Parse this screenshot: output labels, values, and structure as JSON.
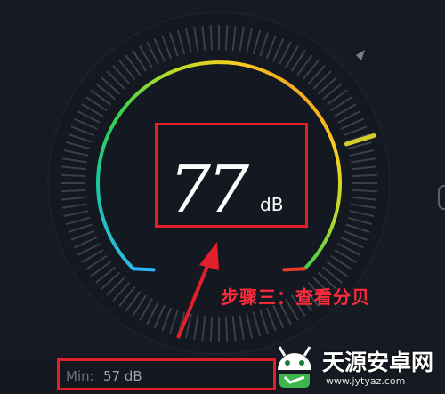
{
  "meter": {
    "reading": "77",
    "unit": "dB",
    "reading_fraction": 0.77,
    "min_label": "Min:",
    "min_value": "57 dB",
    "colors": {
      "background": "#161a22",
      "tick": "#3b3f47",
      "gradient": [
        "#2fb5ff",
        "#18c8a0",
        "#38d34c",
        "#b6d92c",
        "#f4d21e",
        "#f58a22",
        "#ef3b2c"
      ]
    }
  },
  "annotation": {
    "caption": "步骤三：查看分贝",
    "color": "#e2202a"
  },
  "watermark": {
    "title": "天源安卓网",
    "url": "www.jytyaz.com"
  }
}
